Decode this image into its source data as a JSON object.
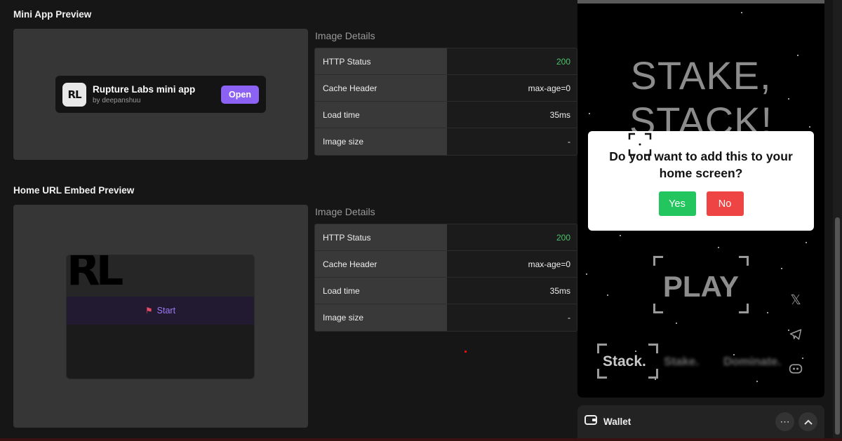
{
  "mini_app_section": {
    "title": "Mini App Preview",
    "card": {
      "logo_text": "RL",
      "name": "Rupture Labs mini app",
      "byline": "by deepanshuu",
      "open_label": "Open"
    },
    "details_title": "Image Details",
    "rows": [
      {
        "key": "HTTP Status",
        "value": "200"
      },
      {
        "key": "Cache Header",
        "value": "max-age=0"
      },
      {
        "key": "Load time",
        "value": "35ms"
      },
      {
        "key": "Image size",
        "value": "-"
      }
    ]
  },
  "embed_section": {
    "title": "Home URL Embed Preview",
    "card": {
      "logo_text": "RL",
      "start_label": "Start"
    },
    "details_title": "Image Details",
    "rows": [
      {
        "key": "HTTP Status",
        "value": "200"
      },
      {
        "key": "Cache Header",
        "value": "max-age=0"
      },
      {
        "key": "Load time",
        "value": "35ms"
      },
      {
        "key": "Image size",
        "value": "-"
      }
    ]
  },
  "game": {
    "title_line1": "STAKE,",
    "title_line2": "STACK!",
    "play_label": "PLAY",
    "tab_stack": "Stack.",
    "tab_stake": "Stake.",
    "tab_dominate": "Dominate.",
    "icons": [
      "x-icon",
      "telegram-icon",
      "discord-icon"
    ]
  },
  "dialog": {
    "question": "Do you want to add this to your home screen?",
    "yes_label": "Yes",
    "no_label": "No"
  },
  "wallet": {
    "label": "Wallet"
  },
  "colors": {
    "accent": "#8b62f3",
    "success": "#4cc36a",
    "yes": "#22c55e",
    "no": "#ef4444"
  }
}
